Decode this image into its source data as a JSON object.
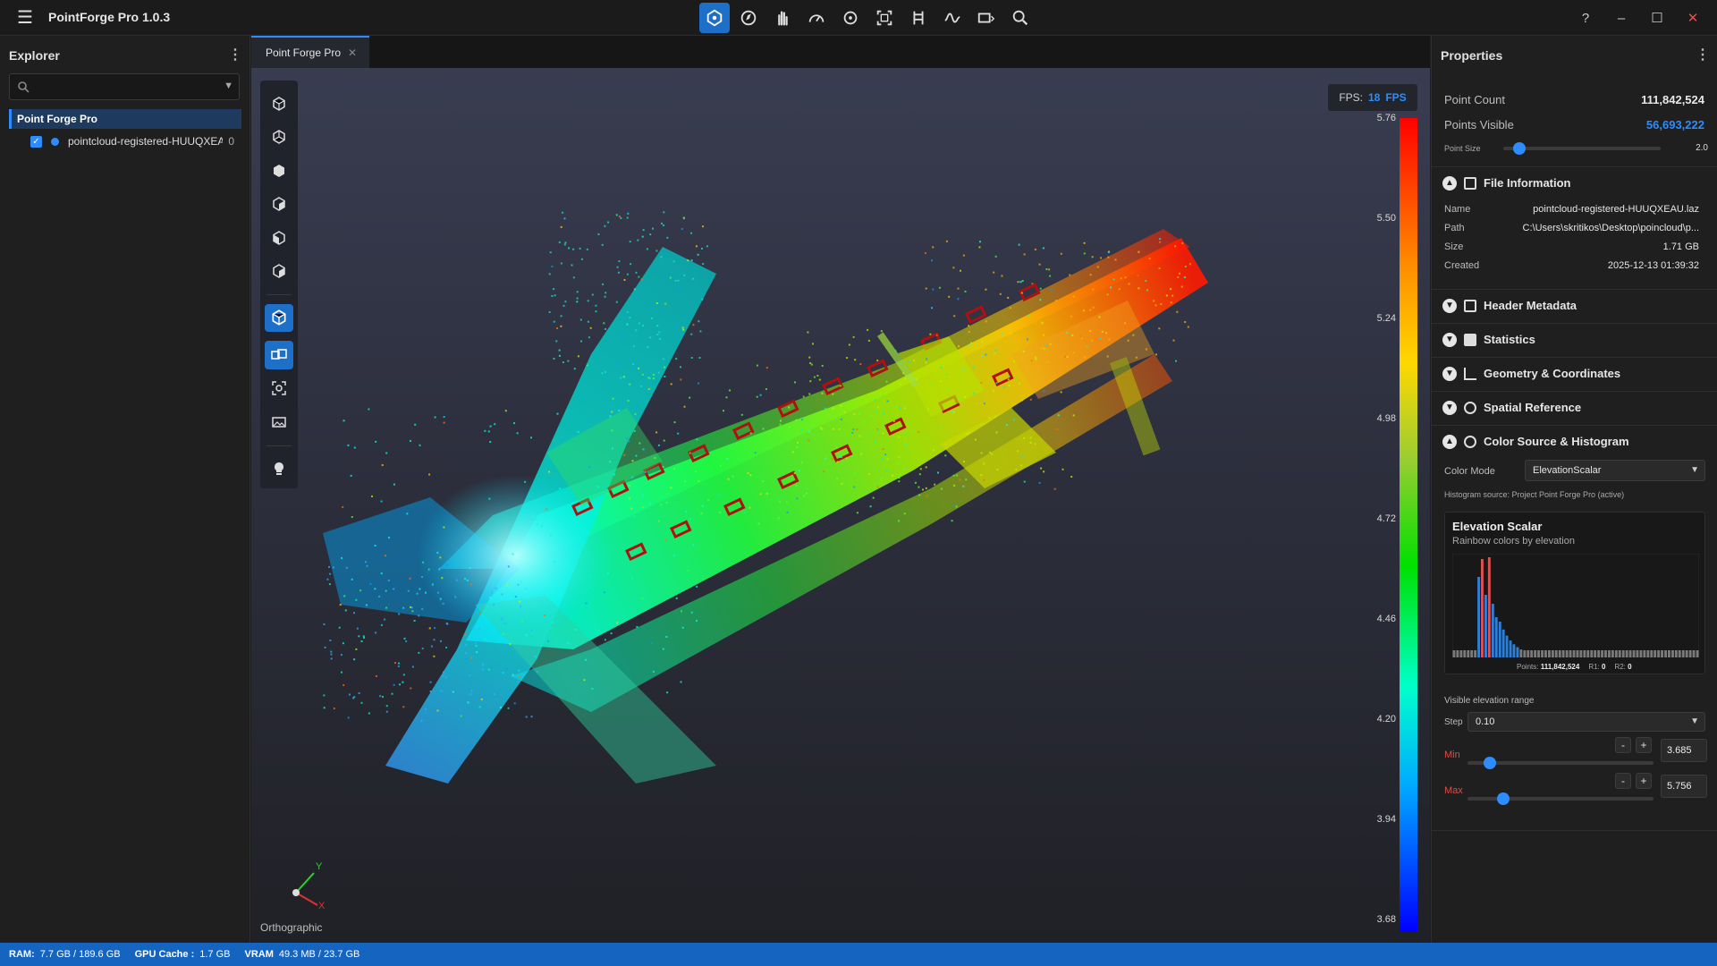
{
  "app": {
    "title": "PointForge Pro 1.0.3"
  },
  "window_controls": {
    "help": "?",
    "minimize": "–",
    "maximize": "☐",
    "close": "✕"
  },
  "explorer": {
    "title": "Explorer",
    "search_placeholder": "",
    "root": "Point Forge Pro",
    "items": [
      {
        "name": "pointcloud-registered-HUUQXEAU.laz",
        "count": "0",
        "checked": true
      }
    ]
  },
  "viewport": {
    "tab": "Point Forge Pro",
    "fps_label": "FPS:",
    "fps_value": "18",
    "fps_unit": "FPS",
    "projection": "Orthographic",
    "axis_x": "X",
    "axis_y": "Y",
    "colorbar_ticks": [
      "5.76",
      "5.50",
      "5.24",
      "4.98",
      "4.72",
      "4.46",
      "4.20",
      "3.94",
      "3.68"
    ]
  },
  "properties": {
    "title": "Properties",
    "point_count_label": "Point Count",
    "point_count": "111,842,524",
    "points_visible_label": "Points Visible",
    "points_visible": "56,693,222",
    "point_size_label": "Point Size",
    "point_size": "2.0",
    "point_size_fraction": 0.1,
    "file_info": {
      "title": "File Information",
      "rows": [
        {
          "k": "Name",
          "v": "pointcloud-registered-HUUQXEAU.laz"
        },
        {
          "k": "Path",
          "v": "C:\\Users\\skritikos\\Desktop\\poincloud\\p..."
        },
        {
          "k": "Size",
          "v": "1.71 GB"
        },
        {
          "k": "Created",
          "v": "2025-12-13 01:39:32"
        }
      ]
    },
    "sections": [
      "Header Metadata",
      "Statistics",
      "Geometry & Coordinates",
      "Spatial Reference"
    ],
    "color_section": "Color Source & Histogram",
    "color_mode_label": "Color Mode",
    "color_mode": "ElevationScalar",
    "hist_source": "Histogram source: Project Point Forge Pro (active)",
    "hist_title": "Elevation Scalar",
    "hist_subtitle": "Rainbow colors by elevation",
    "hist_points_label": "Points:",
    "hist_points": "111,842,524",
    "hist_r1_label": "R1:",
    "hist_r1": "0",
    "hist_r2_label": "R2:",
    "hist_r2": "0",
    "range_title": "Visible elevation range",
    "step_label": "Step",
    "step_value": "0.10",
    "min_label": "Min",
    "min_value": "3.685",
    "min_fraction": 0.12,
    "max_label": "Max",
    "max_value": "5.756",
    "max_fraction": 0.19,
    "minus": "-",
    "plus": "+"
  },
  "status": {
    "ram_label": "RAM:",
    "ram": "7.7 GB / 189.6 GB",
    "gpu_label": "GPU Cache :",
    "gpu": "1.7 GB",
    "vram_label": "VRAM",
    "vram": "49.3 MB / 23.7 GB"
  },
  "colors": {
    "accent": "#2d8cff",
    "status_bar": "#1565c0",
    "min_max_label": "#e04a4a"
  }
}
